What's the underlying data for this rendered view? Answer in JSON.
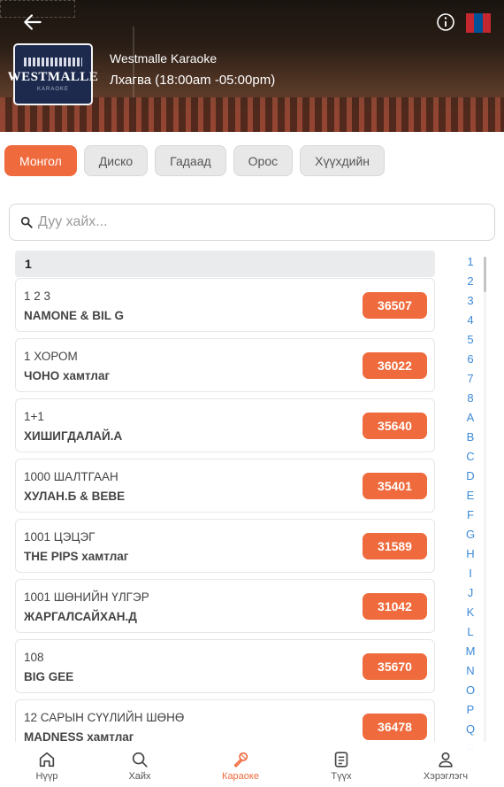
{
  "header": {
    "venue_name": "Westmalle Karaoke",
    "hours": "Лхагва (18:00am -05:00pm)",
    "logo_text": "WESTMALLE",
    "logo_sub": "KARAOKE",
    "flag_colors": [
      "#c4272f",
      "#015197",
      "#c4272f"
    ]
  },
  "tabs": [
    {
      "label": "Монгол",
      "active": true
    },
    {
      "label": "Диско"
    },
    {
      "label": "Гадаад"
    },
    {
      "label": "Орос"
    },
    {
      "label": "Хүүхдийн"
    }
  ],
  "search": {
    "placeholder": "Дуу хайх..."
  },
  "section_label": "1",
  "songs": [
    {
      "title": "1 2 3",
      "artist": "NAMONE & BIL G",
      "code": "36507"
    },
    {
      "title": "1 ХОРОМ",
      "artist": "ЧОНО хамтлаг",
      "code": "36022"
    },
    {
      "title": "1+1",
      "artist": "ХИШИГДАЛАЙ.А",
      "code": "35640"
    },
    {
      "title": "1000 ШАЛТГААН",
      "artist": "ХУЛАН.Б & BEBE",
      "code": "35401"
    },
    {
      "title": "1001 ЦЭЦЭГ",
      "artist": "THE PIPS хамтлаг",
      "code": "31589"
    },
    {
      "title": "1001 ШӨНИЙН ҮЛГЭР",
      "artist": "ЖАРГАЛСАЙХАН.Д",
      "code": "31042"
    },
    {
      "title": "108",
      "artist": "BIG GEE",
      "code": "35670"
    },
    {
      "title": "12 САРЫН СҮҮЛИЙН ШӨНӨ",
      "artist": "MADNESS хамтлаг",
      "code": "36478"
    }
  ],
  "index": [
    "1",
    "2",
    "3",
    "4",
    "5",
    "6",
    "7",
    "8",
    "A",
    "B",
    "C",
    "D",
    "E",
    "F",
    "G",
    "H",
    "I",
    "J",
    "K",
    "L",
    "M",
    "N",
    "O",
    "P",
    "Q",
    "R"
  ],
  "nav": [
    {
      "label": "Нүүр",
      "icon": "home-icon"
    },
    {
      "label": "Хайх",
      "icon": "search-icon"
    },
    {
      "label": "Караоке",
      "icon": "microphone-icon",
      "active": true
    },
    {
      "label": "Түүх",
      "icon": "history-icon"
    },
    {
      "label": "Хэрэглэгч",
      "icon": "user-icon"
    }
  ],
  "colors": {
    "accent": "#ef6a3c",
    "index_link": "#3c8ad8"
  }
}
